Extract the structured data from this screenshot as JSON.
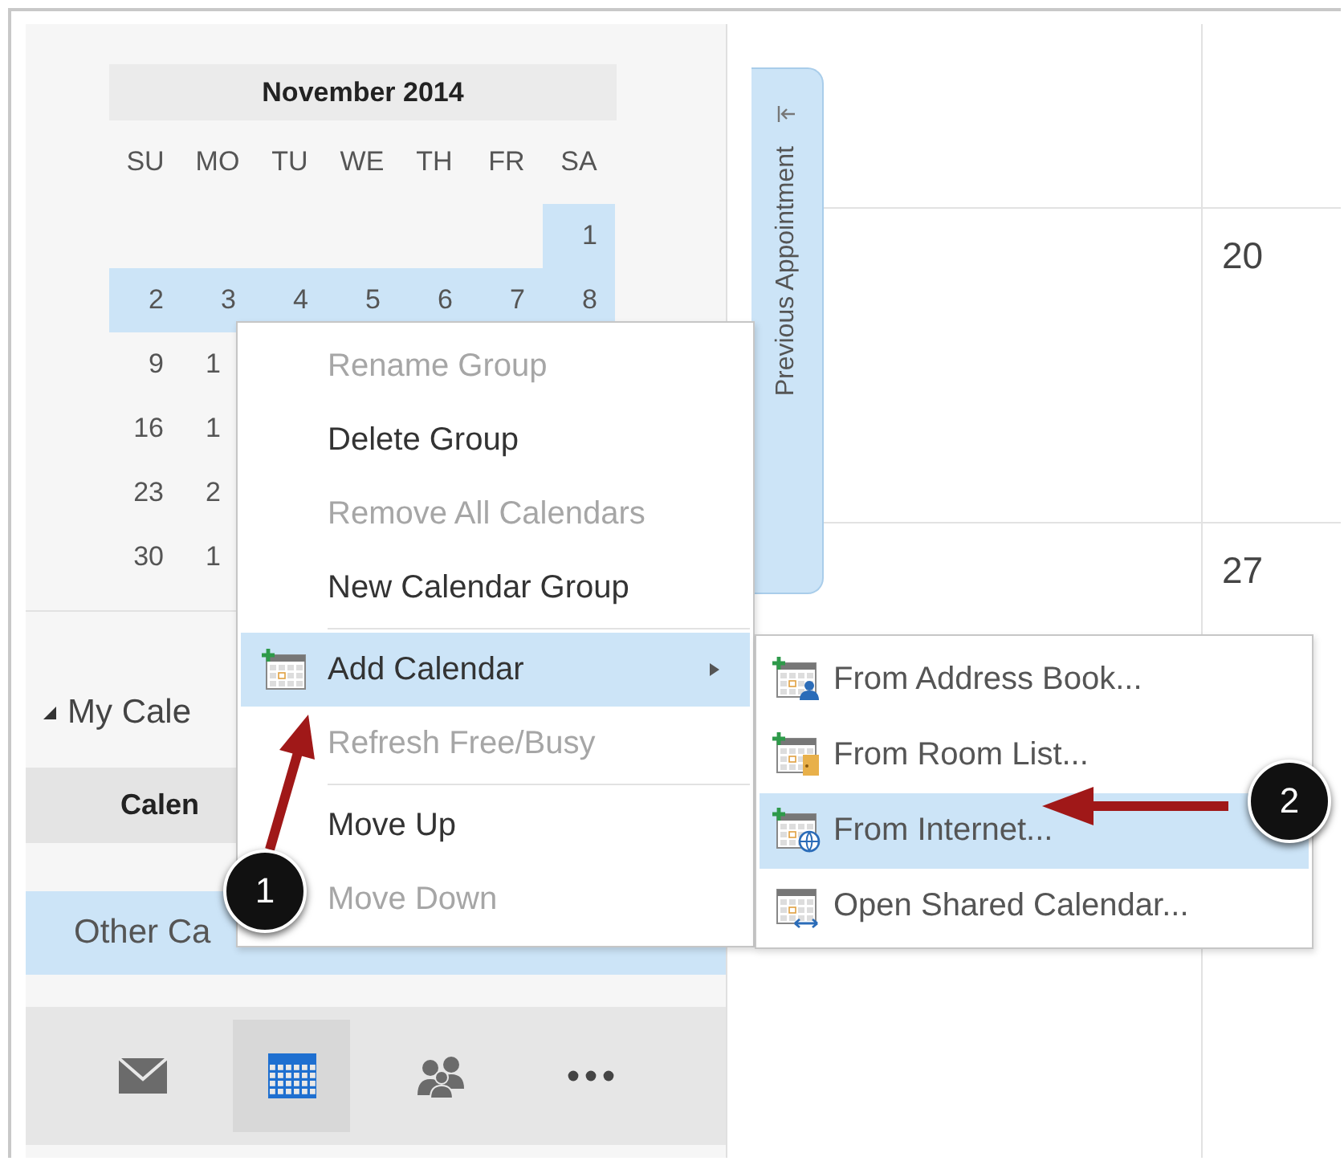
{
  "mini_calendar": {
    "title": "November 2014",
    "weekdays": [
      "SU",
      "MO",
      "TU",
      "WE",
      "TH",
      "FR",
      "SA"
    ],
    "weeks": [
      {
        "days": [
          {
            "kind": "empty"
          },
          {
            "kind": "empty"
          },
          {
            "kind": "empty"
          },
          {
            "kind": "empty"
          },
          {
            "kind": "empty"
          },
          {
            "kind": "empty"
          },
          {
            "kind": "day",
            "text": "1",
            "selected": true
          }
        ]
      },
      {
        "days": [
          {
            "kind": "day",
            "text": "2",
            "selected": true
          },
          {
            "kind": "day",
            "text": "3",
            "selected": true
          },
          {
            "kind": "day",
            "text": "4",
            "selected": true
          },
          {
            "kind": "day",
            "text": "5",
            "selected": true
          },
          {
            "kind": "day",
            "text": "6",
            "selected": true
          },
          {
            "kind": "day",
            "text": "7",
            "selected": true
          },
          {
            "kind": "day",
            "text": "8",
            "selected": true
          }
        ]
      },
      {
        "days": [
          {
            "kind": "day",
            "text": "9",
            "selected": false
          },
          {
            "kind": "clipped",
            "text": "1",
            "selected": false
          }
        ]
      },
      {
        "days": [
          {
            "kind": "day",
            "text": "16",
            "selected": false
          },
          {
            "kind": "clipped",
            "text": "1",
            "selected": false
          }
        ]
      },
      {
        "days": [
          {
            "kind": "day",
            "text": "23",
            "selected": false
          },
          {
            "kind": "clipped",
            "text": "2",
            "selected": false
          }
        ]
      },
      {
        "days": [
          {
            "kind": "day",
            "text": "30",
            "selected": false
          },
          {
            "kind": "clipped",
            "text": "1",
            "selected": false
          }
        ]
      }
    ]
  },
  "folder_pane": {
    "group": {
      "label": "My Cale",
      "expanded": true
    },
    "column_header": "Calen",
    "items": [
      {
        "label": "Other Ca",
        "selected": true
      }
    ]
  },
  "navigation": [
    {
      "kind": "mail",
      "selected": false
    },
    {
      "kind": "calendar",
      "selected": true
    },
    {
      "kind": "people",
      "selected": false
    },
    {
      "kind": "more",
      "selected": false
    }
  ],
  "previous_appointment": {
    "label": "Previous Appointment"
  },
  "calendar_grid": {
    "dates": [
      "20",
      "27"
    ]
  },
  "context_menu": {
    "items": [
      {
        "kind": "item",
        "label": "Rename Group",
        "disabled": true,
        "selected": false
      },
      {
        "kind": "item",
        "label": "Delete Group",
        "disabled": false,
        "selected": false
      },
      {
        "kind": "item",
        "label": "Remove All Calendars",
        "disabled": true,
        "selected": false
      },
      {
        "kind": "item",
        "label": "New Calendar Group",
        "disabled": false,
        "selected": false
      },
      {
        "kind": "separator"
      },
      {
        "kind": "submenu",
        "label": "Add Calendar",
        "disabled": false,
        "selected": true
      },
      {
        "kind": "item",
        "label": "Refresh Free/Busy",
        "disabled": true,
        "selected": false
      },
      {
        "kind": "separator"
      },
      {
        "kind": "item",
        "label": "Move Up",
        "disabled": false,
        "selected": false
      },
      {
        "kind": "item",
        "label": "Move Down",
        "disabled": true,
        "selected": false
      }
    ]
  },
  "submenu": {
    "items": [
      {
        "kind": "person",
        "label": "From Address Book...",
        "selected": false
      },
      {
        "kind": "room",
        "label": "From Room List...",
        "selected": false
      },
      {
        "kind": "globe",
        "label": "From Internet...",
        "selected": true
      },
      {
        "kind": "shared",
        "label": "Open Shared Calendar...",
        "selected": false
      }
    ]
  },
  "callouts": [
    {
      "number": "1"
    },
    {
      "number": "2"
    }
  ]
}
